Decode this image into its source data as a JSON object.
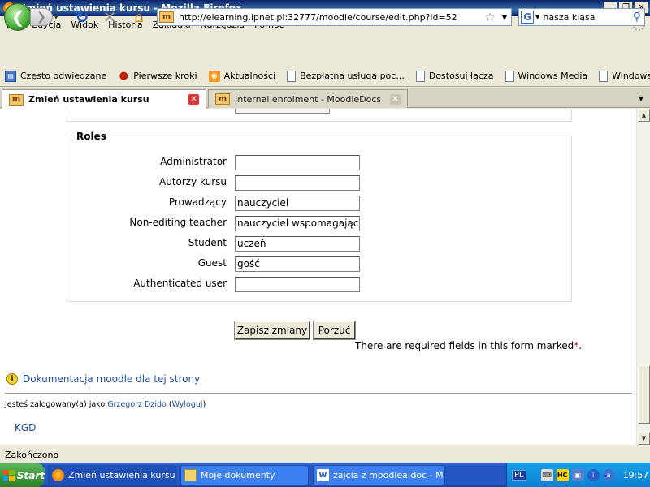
{
  "window": {
    "title": "Zmień ustawienia kursu - Mozilla Firefox",
    "minimize": "_",
    "maximize": "❐",
    "close": "✕"
  },
  "menu": [
    "Plik",
    "Edycja",
    "Widok",
    "Historia",
    "Zakładki",
    "Narzędzia",
    "Pomoc"
  ],
  "nav": {
    "url": "http://elearning.ipnet.pl:32777/moodle/course/edit.php?id=52",
    "search_value": "nasza klasa",
    "search_engine": "G"
  },
  "bookmarks": [
    "Często odwiedzane",
    "Pierwsze kroki",
    "Aktualności",
    "Bezpłatna usługa poc...",
    "Dostosuj łącza",
    "Windows Media",
    "Windows"
  ],
  "tabs": [
    {
      "label": "Zmień ustawienia kursu",
      "active": true
    },
    {
      "label": "Internal enrolment - MoodleDocs",
      "active": false
    }
  ],
  "roles": {
    "legend": "Roles",
    "items": [
      {
        "label": "Administrator",
        "value": ""
      },
      {
        "label": "Autorzy kursu",
        "value": ""
      },
      {
        "label": "Prowadzący",
        "value": "nauczyciel"
      },
      {
        "label": "Non-editing teacher",
        "value": "nauczyciel wspomagający"
      },
      {
        "label": "Student",
        "value": "uczeń"
      },
      {
        "label": "Guest",
        "value": "gość"
      },
      {
        "label": "Authenticated user",
        "value": ""
      }
    ]
  },
  "form": {
    "save_label": "Zapisz zmiany",
    "cancel_label": "Porzuć",
    "required_note": "There are required fields in this form marked",
    "required_star": "*",
    "required_end": "."
  },
  "footer": {
    "doc_link": "Dokumentacja moodle dla tej strony",
    "login_prefix": "Jesteś zalogowany(a) jako ",
    "user_name": "Grzegorz Dzido",
    "logout": "Wyloguj",
    "course_short": "KGD"
  },
  "status": "Zakończono",
  "taskbar": {
    "start": "Start",
    "tasks": [
      "Zmień ustawienia kursu -...",
      "Moje dokumenty",
      "zajcia z moodlea.doc - Mi..."
    ],
    "lang": "PL",
    "clock": "19:57"
  }
}
